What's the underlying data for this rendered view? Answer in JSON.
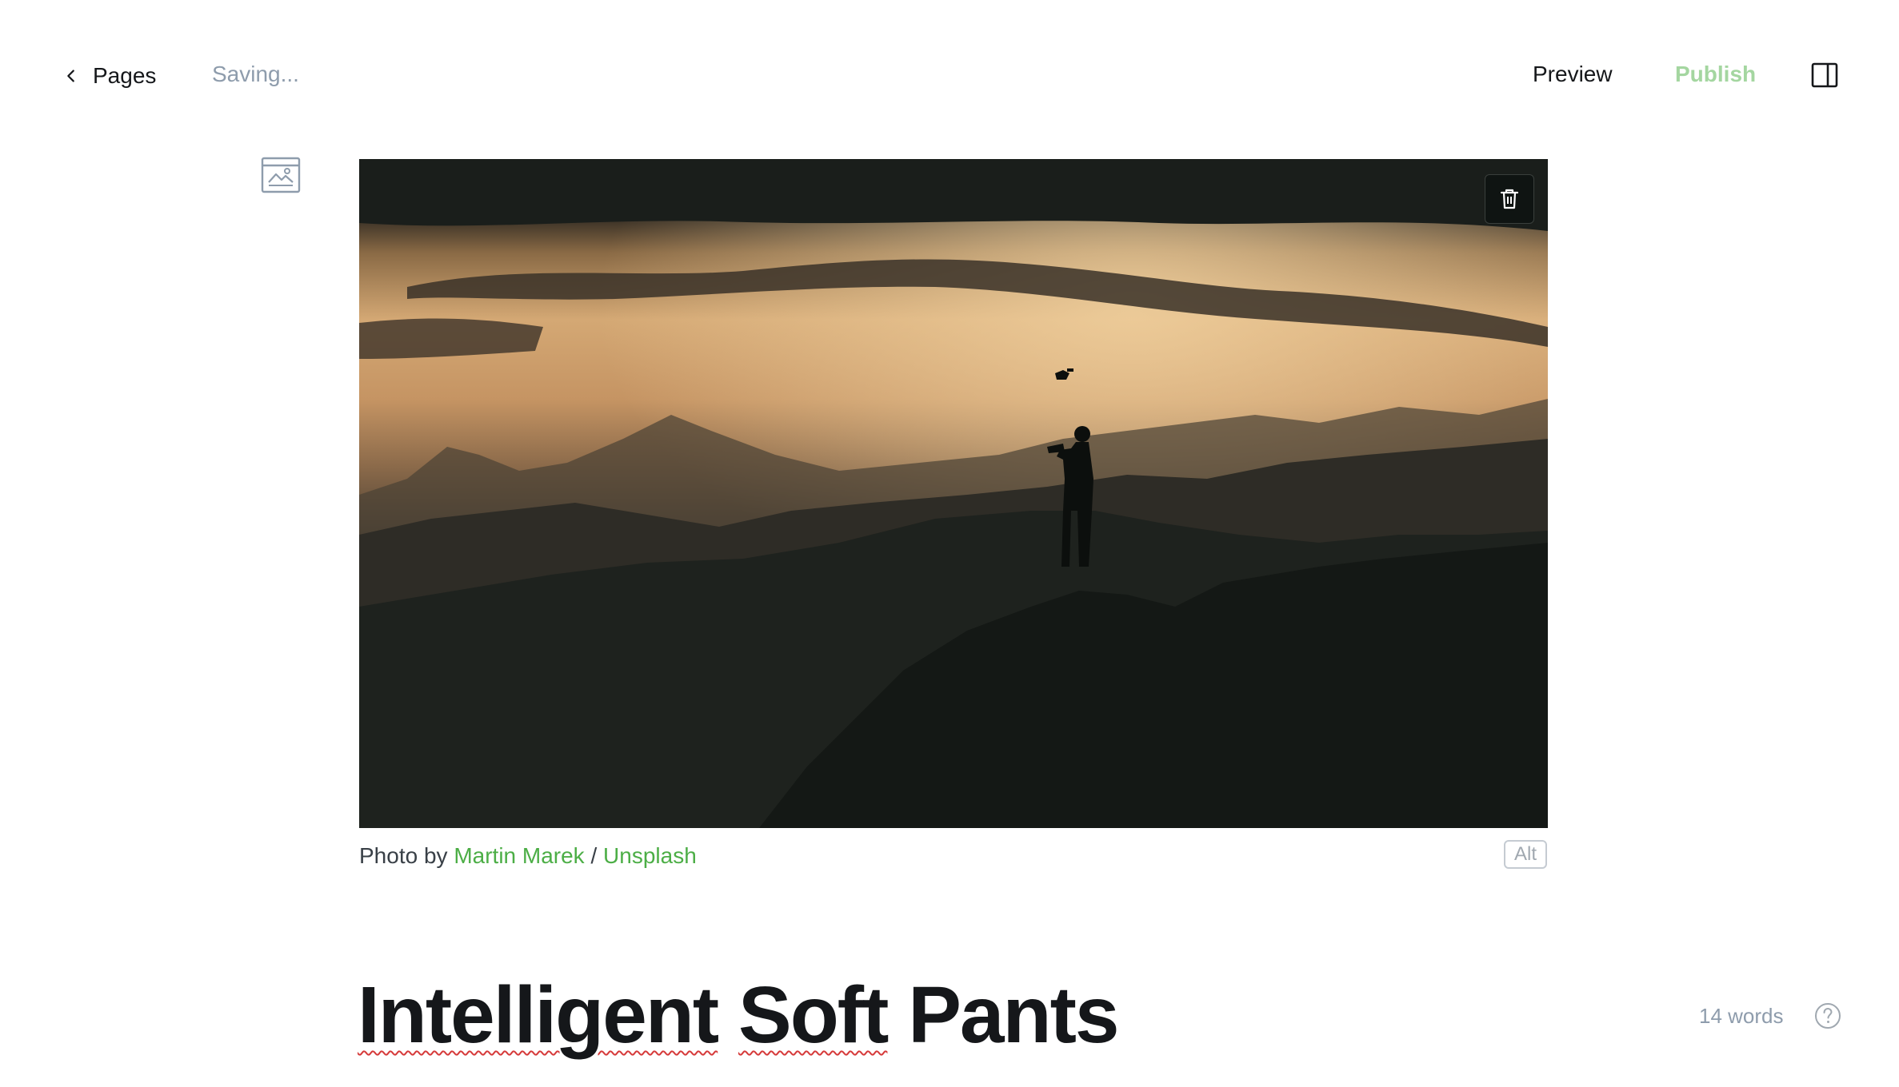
{
  "topbar": {
    "back_label": "Pages",
    "status_text": "Saving...",
    "preview_label": "Preview",
    "publish_label": "Publish",
    "publish_color": "#a4d6a0"
  },
  "feature_image": {
    "caption_prefix": "Photo by",
    "author": "Martin Marek",
    "separator": "/",
    "source": "Unsplash",
    "alt_label": "Alt",
    "link_color": "#4cae46"
  },
  "post": {
    "title_words": [
      "Intelligent",
      "Soft",
      "Pants"
    ]
  },
  "footer": {
    "word_count": "14 words"
  },
  "icons": {
    "back": "chevron-left-icon",
    "sidebar": "sidebar-toggle-icon",
    "image_card": "image-icon",
    "delete": "trash-icon",
    "help": "question-circle-icon"
  }
}
